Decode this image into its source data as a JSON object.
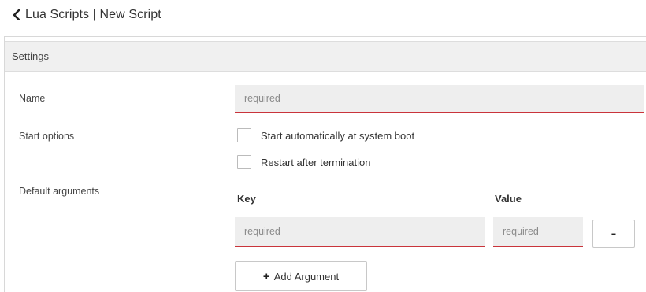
{
  "header": {
    "back_icon": "chevron-left-icon",
    "title": "Lua Scripts | New Script"
  },
  "panel": {
    "heading": "Settings"
  },
  "form": {
    "name_label": "Name",
    "name_placeholder": "required",
    "start_options_label": "Start options",
    "start_auto_label": "Start automatically at system boot",
    "restart_label": "Restart after termination",
    "default_args_label": "Default arguments",
    "key_header": "Key",
    "value_header": "Value",
    "key_placeholder": "required",
    "value_placeholder": "required",
    "remove_label": "-",
    "add_argument_label": "Add Argument",
    "plus_icon": "+"
  },
  "colors": {
    "accent_underline": "#c9343b",
    "input_bg": "#eeeeee",
    "heading_bg": "#f0f0f0"
  }
}
